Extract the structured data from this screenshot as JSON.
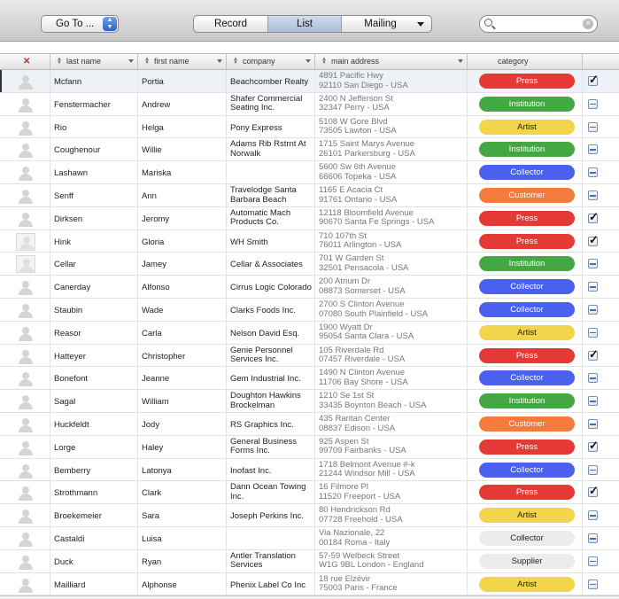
{
  "toolbar": {
    "goto_label": "Go To ...",
    "views": [
      "Record",
      "List",
      "Mailing"
    ],
    "active_view": "List",
    "search_placeholder": ""
  },
  "columns": {
    "delete": "✕",
    "last_name": "last name",
    "first_name": "first name",
    "company": "company",
    "main_address": "main address",
    "category": "category"
  },
  "category_colors": {
    "Press": "#e53935",
    "Institution": "#43a843",
    "Artist": "#f2d54a",
    "Collector": "#4a60ee",
    "Customer": "#f47a3e",
    "Supplier": "#ececec"
  },
  "rows": [
    {
      "last": "Mcfann",
      "first": "Portia",
      "company": [
        "Beachcomber Realty"
      ],
      "addr1": "4891 Pacific Hwy",
      "addr2": "92110 San Diego - USA",
      "category": "Press",
      "checked": true,
      "avatar": "person"
    },
    {
      "last": "Fenstermacher",
      "first": "Andrew",
      "company": [
        "Shafer Commercial",
        "Seating Inc."
      ],
      "addr1": "2400 N Jefferson St",
      "addr2": "32347 Perry - USA",
      "category": "Institution",
      "checked": false,
      "avatar": "person"
    },
    {
      "last": "Rio",
      "first": "Helga",
      "company": [
        "Pony Express"
      ],
      "addr1": "5108 W Gore Blvd",
      "addr2": "73505 Lawton - USA",
      "category": "Artist",
      "checked": false,
      "avatar": "person"
    },
    {
      "last": "Coughenour",
      "first": "Willie",
      "company": [
        "Adams Rib Rstrnt At",
        "Norwalk"
      ],
      "addr1": "1715 Saint Marys Avenue",
      "addr2": "26101 Parkersburg - USA",
      "category": "Institution",
      "checked": false,
      "avatar": "person"
    },
    {
      "last": "Lashawn",
      "first": "Mariska",
      "company": [],
      "addr1": "5600 Sw 6th Avenue",
      "addr2": "66606 Topeka - USA",
      "category": "Collector",
      "checked": false,
      "avatar": "person"
    },
    {
      "last": "Senff",
      "first": "Ann",
      "company": [
        "Travelodge Santa",
        "Barbara Beach"
      ],
      "addr1": "1165 E Acacia Ct",
      "addr2": "91761 Ontario - USA",
      "category": "Customer",
      "checked": false,
      "avatar": "person"
    },
    {
      "last": "Dirksen",
      "first": "Jeromy",
      "company": [
        "Automatic Mach",
        "Products Co."
      ],
      "addr1": "12118 Bloomfield Avenue",
      "addr2": "90670 Santa Fe Springs - USA",
      "category": "Press",
      "checked": true,
      "avatar": "person"
    },
    {
      "last": "Hink",
      "first": "Gloria",
      "company": [
        "WH Smith"
      ],
      "addr1": "710 107th St",
      "addr2": "76011 Arlington - USA",
      "category": "Press",
      "checked": true,
      "avatar": "doc"
    },
    {
      "last": "Cellar",
      "first": "Jamey",
      "company": [
        "Cellar & Associates"
      ],
      "addr1": "701 W Garden St",
      "addr2": "32501 Pensacola - USA",
      "category": "Institution",
      "checked": false,
      "avatar": "doc"
    },
    {
      "last": "Canerday",
      "first": "Alfonso",
      "company": [
        "Cirrus Logic Colorado"
      ],
      "addr1": "200 Atrium Dr",
      "addr2": "08873 Somerset - USA",
      "category": "Collector",
      "checked": false,
      "avatar": "person"
    },
    {
      "last": "Staubin",
      "first": "Wade",
      "company": [
        "Clarks Foods Inc."
      ],
      "addr1": "2700 S Clinton Avenue",
      "addr2": "07080 South Plainfield - USA",
      "category": "Collector",
      "checked": false,
      "avatar": "person"
    },
    {
      "last": "Reasor",
      "first": "Carla",
      "company": [
        "Nelson David Esq."
      ],
      "addr1": "1900 Wyatt Dr",
      "addr2": "95054 Santa Clara - USA",
      "category": "Artist",
      "checked": false,
      "avatar": "person"
    },
    {
      "last": "Hatteyer",
      "first": "Christopher",
      "company": [
        "Genie Personnel",
        "Services Inc."
      ],
      "addr1": "105 Riverdale Rd",
      "addr2": "07457 Riverdale - USA",
      "category": "Press",
      "checked": true,
      "avatar": "person"
    },
    {
      "last": "Bonefont",
      "first": "Jeanne",
      "company": [
        "Gem Industrial Inc."
      ],
      "addr1": "1490 N Clinton Avenue",
      "addr2": "11706 Bay Shore - USA",
      "category": "Collector",
      "checked": false,
      "avatar": "person"
    },
    {
      "last": "Sagal",
      "first": "William",
      "company": [
        "Doughton Hawkins",
        "Brockelman"
      ],
      "addr1": "1210 Se 1st St",
      "addr2": "33435 Boynton Beach - USA",
      "category": "Institution",
      "checked": false,
      "avatar": "person"
    },
    {
      "last": "Huckfeldt",
      "first": "Jody",
      "company": [
        "RS Graphics Inc."
      ],
      "addr1": "435 Raritan Center",
      "addr2": "08837 Edison - USA",
      "category": "Customer",
      "checked": false,
      "avatar": "person"
    },
    {
      "last": "Lorge",
      "first": "Haley",
      "company": [
        "General Business",
        "Forms Inc."
      ],
      "addr1": "925 Aspen St",
      "addr2": "99709 Fairbanks - USA",
      "category": "Press",
      "checked": true,
      "avatar": "person"
    },
    {
      "last": "Bemberry",
      "first": "Latonya",
      "company": [
        "Inofast Inc."
      ],
      "addr1": "1718 Belmont Avenue  #-k",
      "addr2": "21244 Windsor Mill - USA",
      "category": "Collector",
      "checked": false,
      "avatar": "person"
    },
    {
      "last": "Strothmann",
      "first": "Clark",
      "company": [
        "Dann Ocean Towing",
        "Inc."
      ],
      "addr1": "16 Filmore Pl",
      "addr2": "11520 Freeport - USA",
      "category": "Press",
      "checked": true,
      "avatar": "person"
    },
    {
      "last": "Broekemeier",
      "first": "Sara",
      "company": [
        "Joseph Perkins Inc."
      ],
      "addr1": "80 Hendrickson Rd",
      "addr2": "07728 Freehold - USA",
      "category": "Artist",
      "checked": false,
      "avatar": "person"
    },
    {
      "last": "Castaldi",
      "first": "Luisa",
      "company": [],
      "addr1": "Via Nazionale, 22",
      "addr2": "00184 Roma - Italy",
      "category": "Collector",
      "checked": false,
      "avatar": "person"
    },
    {
      "last": "Duck",
      "first": "Ryan",
      "company": [
        "Antler Translation",
        "Services"
      ],
      "addr1": "57-59 Welbeck Street",
      "addr2": "W1G 9BL London - England",
      "category": "Supplier",
      "checked": false,
      "avatar": "person"
    },
    {
      "last": "Mailliard",
      "first": "Alphonse",
      "company": [
        "Phenix Label Co Inc"
      ],
      "addr1": "18 rue Elzévir",
      "addr2": "75003 Paris - France",
      "category": "Artist",
      "checked": false,
      "avatar": "person"
    }
  ]
}
